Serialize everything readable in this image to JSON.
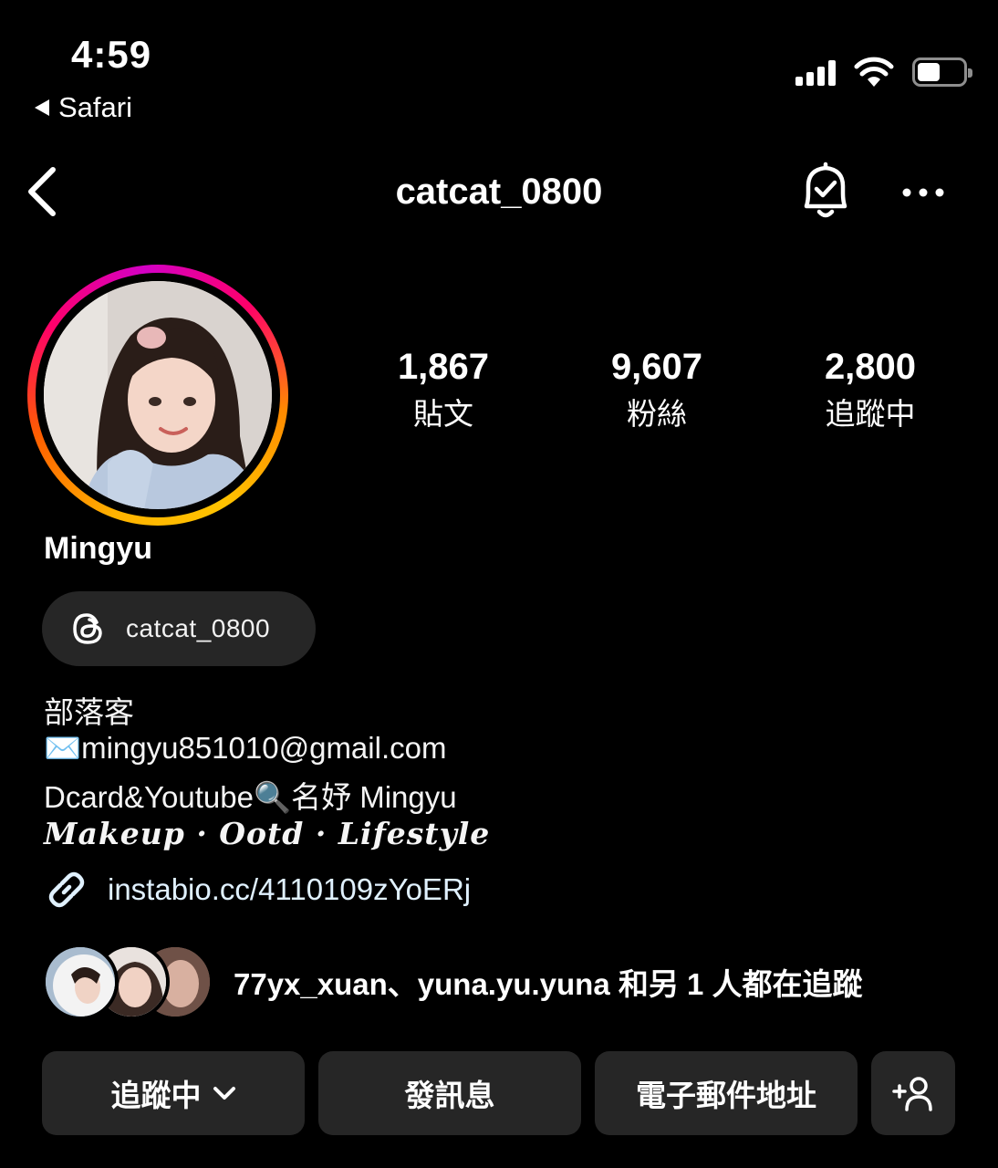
{
  "status_bar": {
    "time": "4:59",
    "back_app": "Safari"
  },
  "nav": {
    "username": "catcat_0800"
  },
  "profile": {
    "stats": [
      {
        "value": "1,867",
        "label": "貼文"
      },
      {
        "value": "9,607",
        "label": "粉絲"
      },
      {
        "value": "2,800",
        "label": "追蹤中"
      }
    ],
    "display_name": "Mingyu",
    "threads_handle": "catcat_0800",
    "bio": {
      "line1": "部落客",
      "line2": "✉️mingyu851010@gmail.com",
      "line3": "Dcard&Youtube🔍名妤 Mingyu",
      "line4": "Makeup · Ootd · Lifestyle"
    },
    "link": "instabio.cc/4110109zYoERj",
    "followed_by": "77yx_xuan、yuna.yu.yuna 和另 1 人都在追蹤"
  },
  "actions": {
    "following": "追蹤中",
    "message": "發訊息",
    "email": "電子郵件地址"
  },
  "colors": {
    "background": "#000000",
    "button": "#262626",
    "link": "#e0f1ff"
  }
}
